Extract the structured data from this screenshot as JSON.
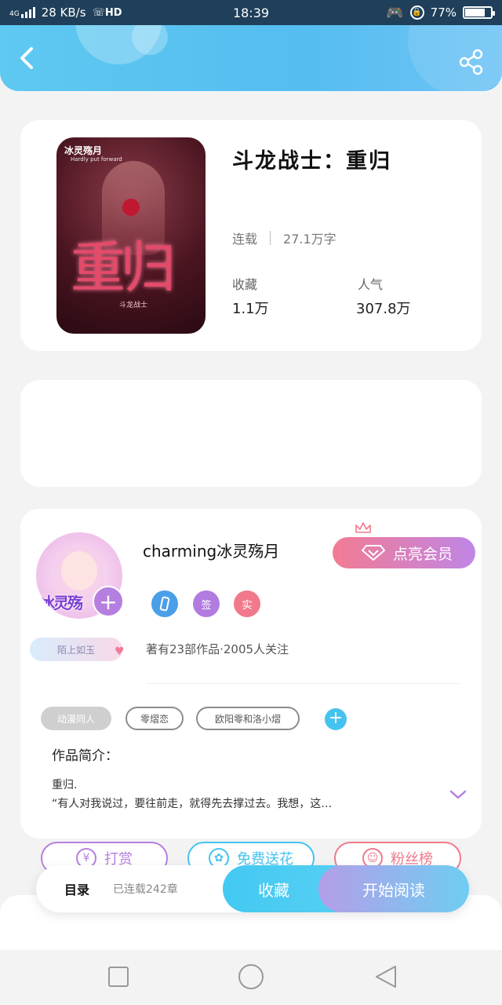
{
  "status_bar": {
    "network": "4G",
    "speed": "28 KB/s",
    "hd": "HD",
    "time": "18:39",
    "battery": "77%",
    "battery_level": 0.77
  },
  "header": {
    "back_icon": "chevron-left-icon",
    "share_icon": "share-icon"
  },
  "book": {
    "cover": {
      "author_text": "冰灵殇月",
      "tagline": "Hardly put forward",
      "title_art": "重归",
      "subtitle_art": "斗龙战士"
    },
    "title": "斗龙战士：重归",
    "status": "连载",
    "word_count": "27.1万字",
    "stats": [
      {
        "label": "收藏",
        "value": "1.1万"
      },
      {
        "label": "人气",
        "value": "307.8万"
      }
    ]
  },
  "author": {
    "avatar_text": "冰灵殇",
    "name": "charming冰灵殇月",
    "vip_button": "点亮会员",
    "badges": [
      {
        "text": "",
        "color": "#4a9fe8"
      },
      {
        "text": "签",
        "color": "#b27be0"
      },
      {
        "text": "实",
        "color": "#f07a8c"
      }
    ],
    "level": "陌上如玉",
    "meta": "著有23部作品·2005人关注",
    "tags": [
      "动漫同人",
      "零熠恋",
      "欧阳零和洛小熠"
    ],
    "intro_heading": "作品简介：",
    "intro_lines": [
      "重归.",
      "“有人对我说过，要往前走，就得先去撑过去。我想，这…"
    ]
  },
  "actions": [
    {
      "label": "打赏",
      "icon": "yen-icon",
      "color": "#b57fe0"
    },
    {
      "label": "免费送花",
      "icon": "flower-icon",
      "color": "#45c3f0"
    },
    {
      "label": "粉丝榜",
      "icon": "fans-icon",
      "color": "#f07a8c"
    }
  ],
  "bottom_bar": {
    "toc_label": "目录",
    "chapter_count": "已连载242章",
    "favorite_button": "收藏",
    "read_button": "开始阅读"
  }
}
